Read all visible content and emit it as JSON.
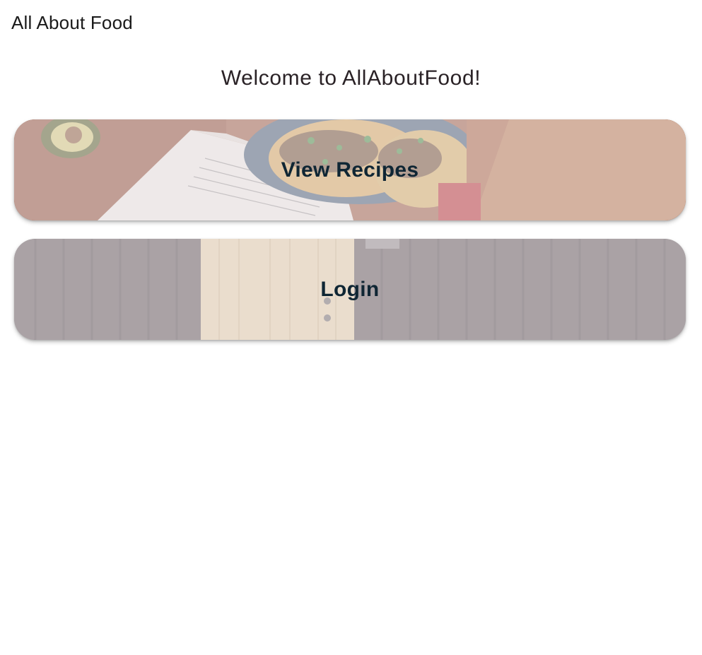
{
  "app_bar": {
    "title": "All About Food"
  },
  "main": {
    "welcome": "Welcome to AllAboutFood!",
    "cards": [
      {
        "label": "View Recipes",
        "image": "food-recipe-photo"
      },
      {
        "label": "Login",
        "image": "door-photo"
      }
    ]
  },
  "colors": {
    "title_text": "#1a1a1a",
    "welcome_text": "#2a2226",
    "card_text": "#0f2634",
    "background": "#ffffff"
  }
}
